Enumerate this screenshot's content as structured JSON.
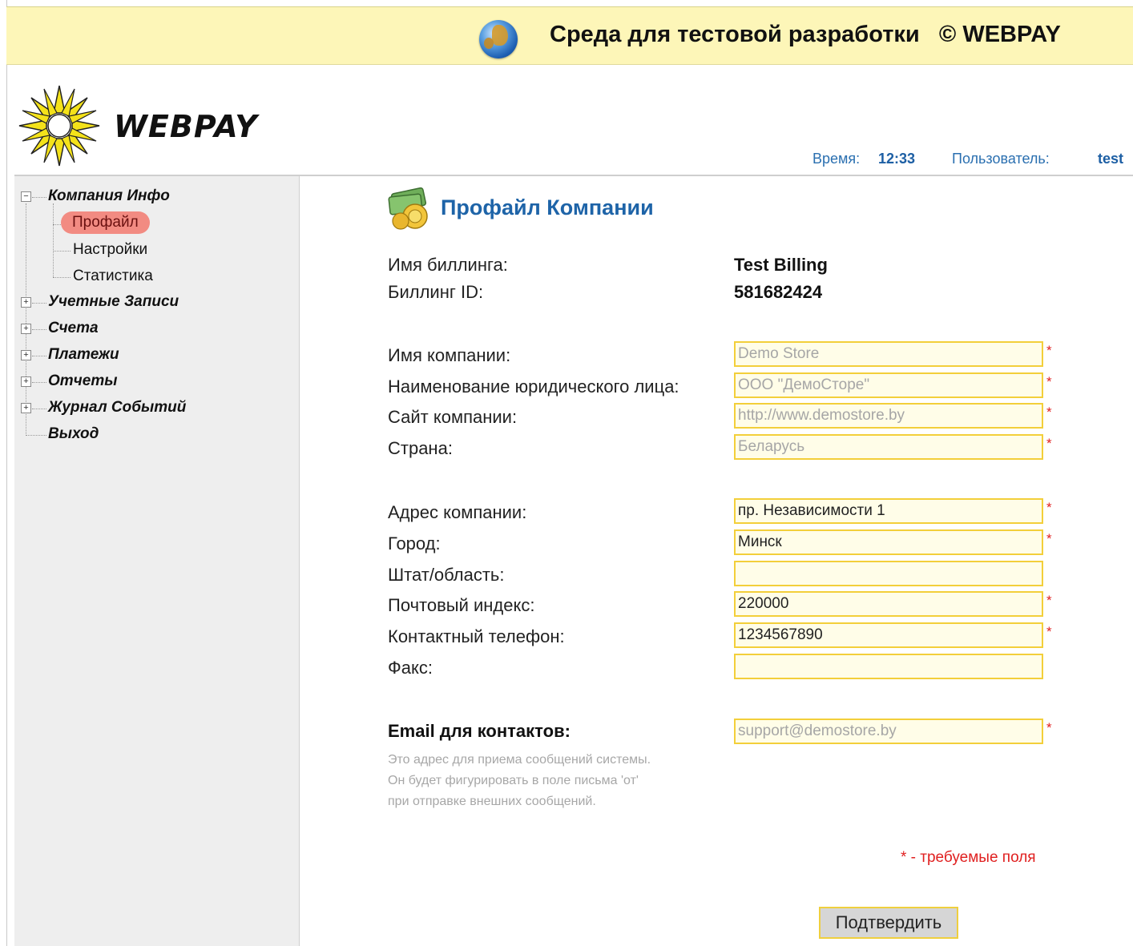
{
  "banner": {
    "title": "Среда для тестовой разработки   © WEBPAY"
  },
  "brand": {
    "name": "WEBPAY"
  },
  "status": {
    "time_label": "Время:",
    "time_value": "12:33",
    "user_label": "Пользователь:",
    "user_value": "test"
  },
  "sidebar": {
    "groups": [
      {
        "label": "Компания Инфо",
        "expanded": true,
        "items": [
          {
            "label": "Профайл",
            "selected": true
          },
          {
            "label": "Настройки"
          },
          {
            "label": "Статистика"
          }
        ]
      },
      {
        "label": "Учетные Записи"
      },
      {
        "label": "Счета"
      },
      {
        "label": "Платежи"
      },
      {
        "label": "Отчеты"
      },
      {
        "label": "Журнал Событий"
      },
      {
        "label": "Выход"
      }
    ],
    "expand_glyph": "+",
    "collapse_glyph": "−"
  },
  "main": {
    "title": "Профайл Компании",
    "billing": {
      "name_label": "Имя биллинга:",
      "name_value": "Test Billing",
      "id_label": "Биллинг ID:",
      "id_value": "581682424"
    },
    "fields": {
      "company_name": {
        "label": "Имя компании:",
        "value": "Demo Store"
      },
      "legal_name": {
        "label": "Наименование юридического лица:",
        "value": "ООО \"ДемоСторе\""
      },
      "website": {
        "label": "Сайт компании:",
        "value": "http://www.demostore.by"
      },
      "country": {
        "label": "Страна:",
        "value": "Беларусь"
      },
      "address": {
        "label": "Адрес компании:",
        "value": "пр. Независимости 1"
      },
      "city": {
        "label": "Город:",
        "value": "Минск"
      },
      "state": {
        "label": "Штат/область:",
        "value": ""
      },
      "zip": {
        "label": "Почтовый индекс:",
        "value": "220000"
      },
      "phone": {
        "label": "Контактный телефон:",
        "value": "1234567890"
      },
      "fax": {
        "label": "Факс:",
        "value": ""
      },
      "email": {
        "label": "Email для контактов:",
        "value": "support@demostore.by"
      }
    },
    "email_help": {
      "line1": "Это адрес для приема сообщений системы.",
      "line2": "Он будет фигурировать в поле письма 'от'",
      "line3": "при отправке внешних сообщений."
    },
    "required_mark": "*",
    "required_note": "* - требуемые поля",
    "submit_label": "Подтвердить"
  },
  "colors": {
    "banner_bg": "#fdf6b8",
    "accent_blue": "#1e64a8",
    "required_red": "#e02020",
    "field_border": "#f3cf3a",
    "field_bg": "#fffde8",
    "selected_pill": "#f28b82"
  }
}
